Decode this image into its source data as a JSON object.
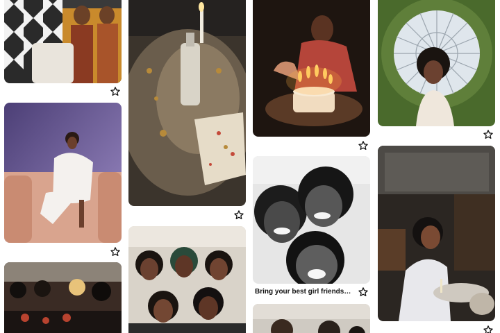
{
  "board": {
    "pins": [
      {
        "id": "pin-1",
        "scene": "patterned fabric portrait with two women",
        "saved": false
      },
      {
        "id": "pin-2",
        "scene": "party table with candle and bottle",
        "saved": false
      },
      {
        "id": "pin-3",
        "scene": "birthday cake with lit candles",
        "saved": false
      },
      {
        "id": "pin-4",
        "scene": "woman in greenery circle",
        "saved": false
      },
      {
        "id": "pin-5",
        "scene": "woman in white on pink sofa",
        "saved": false
      },
      {
        "id": "pin-6",
        "scene": "black and white photobooth friends",
        "saved": false,
        "caption": "Bring your best girl friends to..."
      },
      {
        "id": "pin-7",
        "scene": "woman at restaurant table",
        "saved": false
      },
      {
        "id": "pin-8",
        "scene": "group of women celebrating",
        "saved": false
      },
      {
        "id": "pin-9",
        "scene": "group selfie of friends",
        "saved": false
      },
      {
        "id": "pin-10",
        "scene": "dinner party group",
        "saved": false
      },
      {
        "id": "pin-11",
        "scene": "partial image",
        "saved": false
      }
    ]
  },
  "icons": {
    "save": "star-outline-icon"
  },
  "colors": {
    "background": "#ffffff",
    "icon": "#111111",
    "caption": "#111111"
  }
}
